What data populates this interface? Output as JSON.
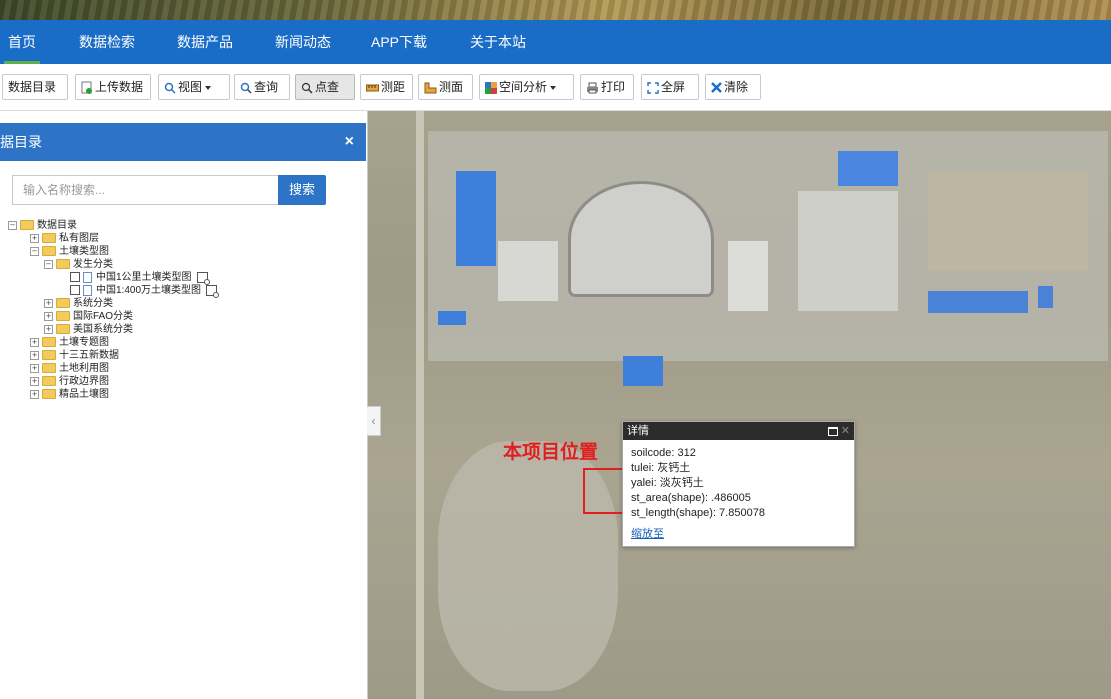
{
  "nav": {
    "items": [
      "首页",
      "数据检索",
      "数据产品",
      "新闻动态",
      "APP下载",
      "关于本站"
    ]
  },
  "toolbar": {
    "buttons": [
      "数据目录",
      "上传数据",
      "视图",
      "查询",
      "点查",
      "测距",
      "测面",
      "空间分析",
      "打印",
      "全屏",
      "清除"
    ]
  },
  "panel": {
    "title": "据目录",
    "close": "×",
    "search_placeholder": "输入名称搜索...",
    "search_button": "搜索",
    "tree": [
      "数据目录",
      "私有图层",
      "土壤类型图",
      "发生分类",
      "中国1公里土壤类型图",
      "中国1:400万土壤类型图",
      "系统分类",
      "国际FAO分类",
      "美国系统分类",
      "土壤专题图",
      "十三五新数据",
      "土地利用图",
      "行政边界图",
      "精品土壤图"
    ]
  },
  "collapse_handle": "‹",
  "map": {
    "label": "本项目位置"
  },
  "popup": {
    "title": "详情",
    "lines": [
      "soilcode: 312",
      "tulei: 灰钙土",
      "yalei: 淡灰钙土",
      "st_area(shape): .486005",
      "st_length(shape): 7.850078"
    ],
    "link": "缩放至"
  },
  "colors": {
    "nav_bg": "#1a6dc7",
    "accent_green": "#5fb04b",
    "marker_red": "#e02020"
  }
}
